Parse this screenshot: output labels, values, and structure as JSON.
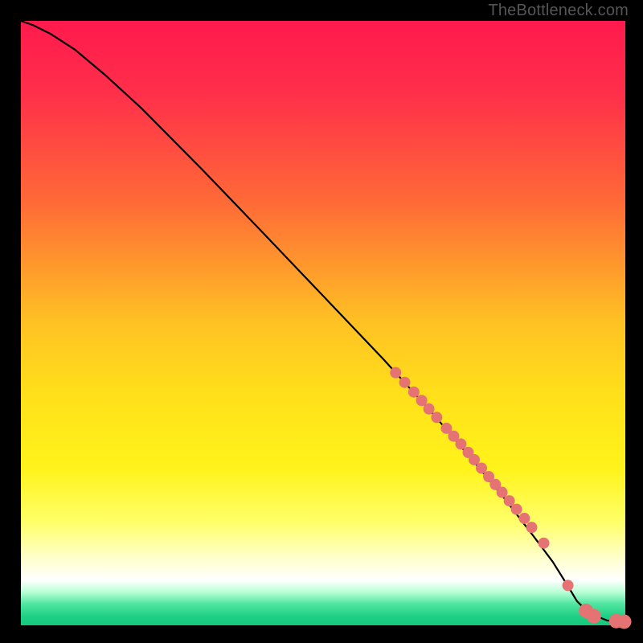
{
  "watermark": "TheBottleneck.com",
  "chart_data": {
    "type": "line",
    "title": "",
    "xlabel": "",
    "ylabel": "",
    "xlim": [
      0,
      100
    ],
    "ylim": [
      0,
      100
    ],
    "gradient_stops": [
      {
        "offset": 0.0,
        "color": "#ff1a4d"
      },
      {
        "offset": 0.12,
        "color": "#ff2f4a"
      },
      {
        "offset": 0.3,
        "color": "#ff6a37"
      },
      {
        "offset": 0.5,
        "color": "#ffc223"
      },
      {
        "offset": 0.62,
        "color": "#ffe01a"
      },
      {
        "offset": 0.74,
        "color": "#fff31a"
      },
      {
        "offset": 0.83,
        "color": "#ffff6a"
      },
      {
        "offset": 0.89,
        "color": "#ffffce"
      },
      {
        "offset": 0.925,
        "color": "#ffffff"
      },
      {
        "offset": 0.945,
        "color": "#b9ffd6"
      },
      {
        "offset": 0.965,
        "color": "#4fe59f"
      },
      {
        "offset": 0.985,
        "color": "#1fd084"
      },
      {
        "offset": 1.0,
        "color": "#15c97b"
      }
    ],
    "series": [
      {
        "name": "bottleneck-curve",
        "x": [
          0.0,
          2.0,
          5.0,
          9.0,
          14.0,
          20.0,
          30.0,
          40.0,
          50.0,
          60.0,
          68.0,
          75.0,
          80.0,
          85.0,
          88.0,
          90.5,
          92.0,
          94.0,
          97.0,
          100.0
        ],
        "y": [
          100.0,
          99.3,
          97.8,
          95.2,
          91.0,
          85.5,
          75.4,
          65.0,
          54.5,
          44.0,
          35.2,
          27.0,
          21.0,
          14.5,
          10.5,
          6.5,
          4.0,
          2.0,
          0.8,
          0.6
        ]
      }
    ],
    "points": {
      "name": "sample-points",
      "color": "#e57373",
      "radius_small": 7,
      "radius_large": 9,
      "x": [
        62.0,
        63.5,
        65.0,
        66.3,
        67.5,
        68.8,
        70.4,
        71.6,
        72.8,
        74.0,
        75.0,
        76.2,
        77.4,
        78.5,
        79.6,
        80.8,
        82.0,
        83.3,
        84.5,
        86.5,
        90.5,
        93.5,
        94.8,
        98.5,
        99.8
      ],
      "y": [
        41.8,
        40.2,
        38.6,
        37.2,
        35.8,
        34.4,
        32.6,
        31.3,
        30.0,
        28.6,
        27.4,
        26.0,
        24.6,
        23.3,
        22.0,
        20.6,
        19.2,
        17.7,
        16.2,
        13.6,
        6.6,
        2.4,
        1.5,
        0.7,
        0.6
      ]
    }
  }
}
